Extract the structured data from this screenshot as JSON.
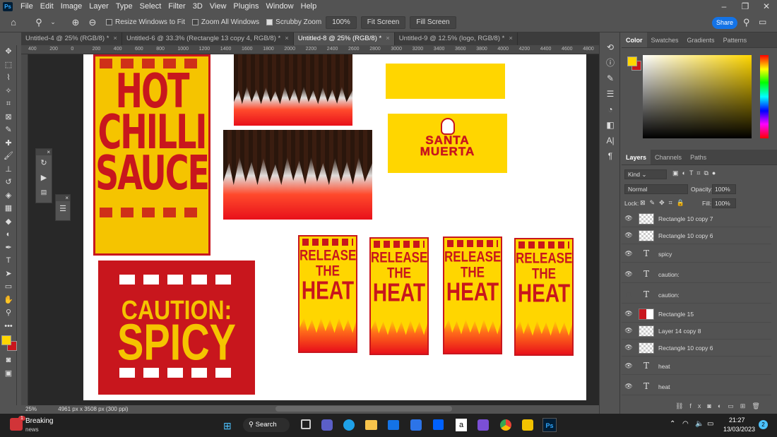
{
  "menubar": {
    "items": [
      "File",
      "Edit",
      "Image",
      "Layer",
      "Type",
      "Select",
      "Filter",
      "3D",
      "View",
      "Plugins",
      "Window",
      "Help"
    ]
  },
  "options": {
    "resize_windows": "Resize Windows to Fit",
    "zoom_all": "Zoom All Windows",
    "scrubby": "Scrubby Zoom",
    "zoom_value": "100%",
    "fit_screen": "Fit Screen",
    "fill_screen": "Fill Screen",
    "share": "Share"
  },
  "tabs": [
    "Untitled-4 @ 25% (RGB/8) *",
    "Untitled-6 @ 33.3% (Rectangle 13 copy 4, RGB/8) *",
    "Untitled-8 @ 25% (RGB/8) *",
    "Untitled-9 @ 12.5% (logo, RGB/8) *"
  ],
  "ruler": [
    "400",
    "200",
    "0",
    "200",
    "400",
    "600",
    "800",
    "1000",
    "1200",
    "1400",
    "1600",
    "1800",
    "2000",
    "2200",
    "2400",
    "2600",
    "2800",
    "3000",
    "3200",
    "3400",
    "3600",
    "3800",
    "4000",
    "4200",
    "4400",
    "4600",
    "4800"
  ],
  "artwork": {
    "hot": [
      "HOT",
      "CHILLI",
      "SAUCE"
    ],
    "caution": [
      "CAUTION:",
      "SPICY"
    ],
    "santa": [
      "SANTA",
      "MUERTA"
    ],
    "release": [
      "RELEASE",
      "THE",
      "HEAT"
    ]
  },
  "status": {
    "zoom": "25%",
    "doc": "4961 px x 3508 px (300 ppi)"
  },
  "color_panel": {
    "tabs": [
      "Color",
      "Swatches",
      "Gradients",
      "Patterns"
    ],
    "fg": "#ffd600",
    "bg": "#c8161d"
  },
  "layers_panel": {
    "tabs": [
      "Layers",
      "Channels",
      "Paths"
    ],
    "kind": "Kind",
    "blend": "Normal",
    "opacity_label": "Opacity:",
    "opacity": "100%",
    "lock_label": "Lock:",
    "fill_label": "Fill:",
    "fill": "100%",
    "layers": [
      {
        "name": "Rectangle 10 copy 7",
        "type": "raster",
        "visible": true
      },
      {
        "name": "Rectangle 10 copy 6",
        "type": "raster",
        "visible": true
      },
      {
        "name": "spicy",
        "type": "text",
        "visible": true
      },
      {
        "name": "caution:",
        "type": "text",
        "visible": true
      },
      {
        "name": "caution:",
        "type": "text",
        "visible": false
      },
      {
        "name": "Rectangle 15",
        "type": "raster-red",
        "visible": true
      },
      {
        "name": "Layer 14 copy 8",
        "type": "raster",
        "visible": true
      },
      {
        "name": "Rectangle 10 copy 6",
        "type": "raster",
        "visible": true
      },
      {
        "name": "heat",
        "type": "text",
        "visible": true
      },
      {
        "name": "heat",
        "type": "text",
        "visible": true
      }
    ]
  },
  "taskbar": {
    "news_title": "Breaking",
    "news_sub": "news",
    "news_badge": "1",
    "search": "Search",
    "time": "21:27",
    "date": "13/03/2023",
    "notif": "2"
  }
}
